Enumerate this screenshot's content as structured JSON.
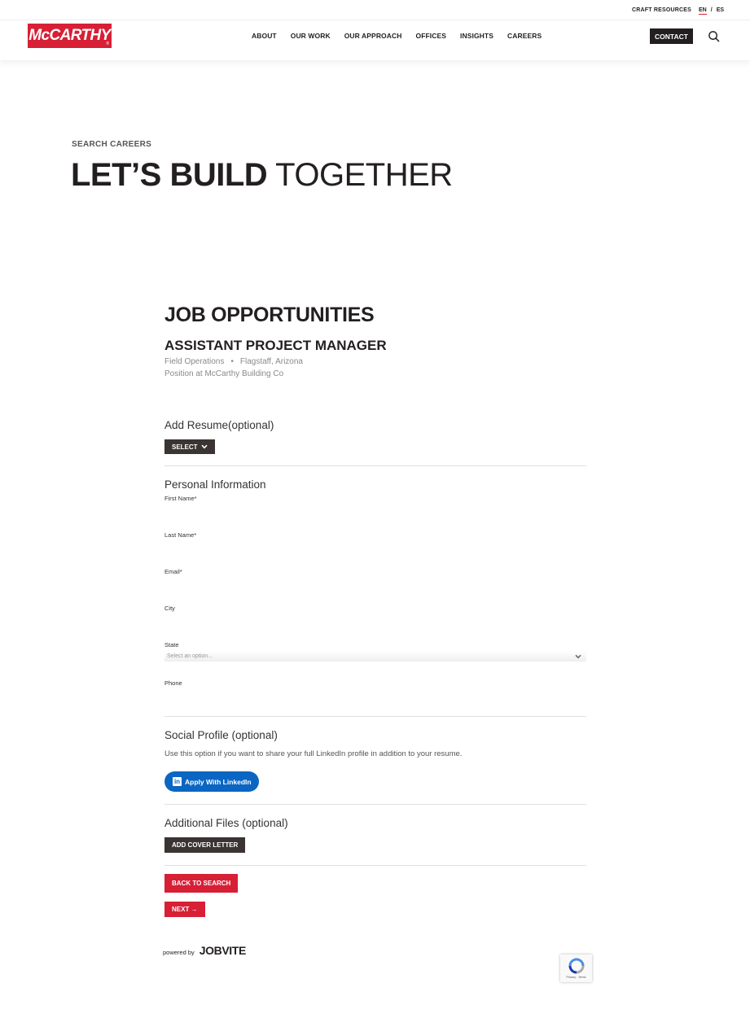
{
  "header": {
    "utility": {
      "craft_resources": "CRAFT RESOURCES",
      "lang_en": "EN",
      "lang_sep": "/",
      "lang_es": "ES"
    },
    "logo_text": "McCARTHY",
    "logo_reg": "®",
    "nav": [
      "ABOUT",
      "OUR WORK",
      "OUR APPROACH",
      "OFFICES",
      "INSIGHTS",
      "CAREERS"
    ],
    "contact_label": "CONTACT"
  },
  "hero": {
    "eyebrow": "SEARCH CAREERS",
    "title_bold": "LET’S BUILD",
    "title_light": "TOGETHER"
  },
  "job": {
    "section_heading": "JOB OPPORTUNITIES",
    "title": "ASSISTANT PROJECT MANAGER",
    "department": "Field Operations",
    "separator": "•",
    "location": "Flagstaff, Arizona",
    "company_line": "Position at McCarthy Building Co"
  },
  "resume": {
    "title": "Add Resume(optional)",
    "select_label": "SELECT"
  },
  "personal": {
    "title": "Personal Information",
    "first_name": "First Name*",
    "last_name": "Last Name*",
    "email": "Email*",
    "city": "City",
    "state": "State",
    "state_placeholder": "Select an option...",
    "phone": "Phone"
  },
  "social": {
    "title": "Social Profile (optional)",
    "description": "Use this option if you want to share your full LinkedIn profile in addition to your resume.",
    "linkedin_label": "Apply With LinkedIn",
    "linkedin_logo": "in"
  },
  "files": {
    "title": "Additional Files (optional)",
    "cover_letter_label": "ADD COVER LETTER"
  },
  "actions": {
    "back_label": "BACK TO SEARCH",
    "next_label": "NEXT →"
  },
  "footer": {
    "powered_by": "powered by",
    "jobvite": "JOBVITE",
    "recaptcha_links": "Privacy - Terms"
  },
  "colors": {
    "brand_red": "#d71f36",
    "dark": "#231f20",
    "linkedin_blue": "#0a66c2"
  }
}
